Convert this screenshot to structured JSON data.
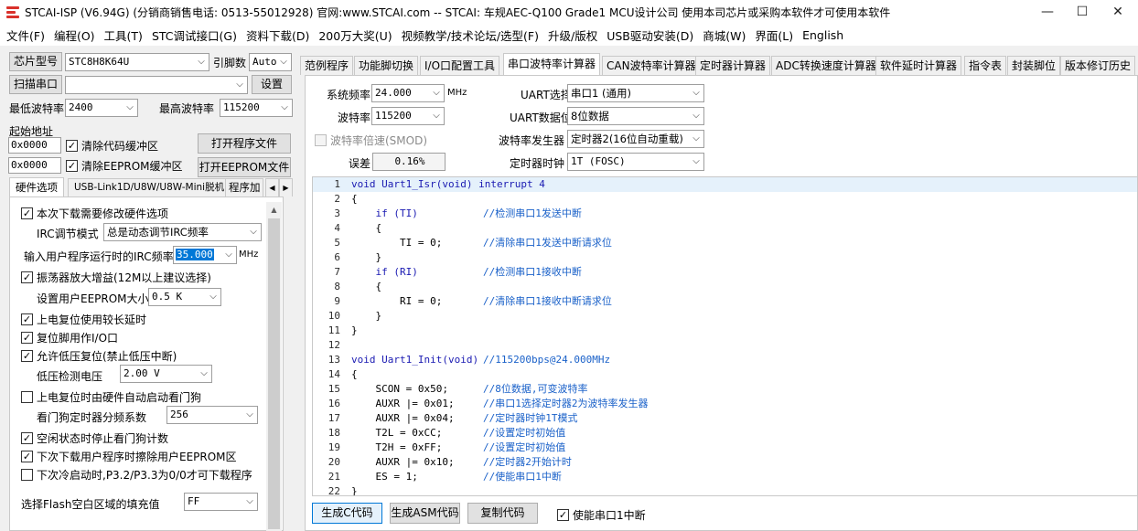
{
  "window": {
    "title": "STCAI-ISP (V6.94G) (分销商销售电话: 0513-55012928) 官网:www.STCAI.com  -- STCAI: 车规AEC-Q100 Grade1 MCU设计公司 使用本司芯片或采购本软件才可使用本软件",
    "minimize": "—",
    "maximize": "☐",
    "close": "✕"
  },
  "menu": [
    "文件(F)",
    "编程(O)",
    "工具(T)",
    "STC调试接口(G)",
    "资料下载(D)",
    "200万大奖(U)",
    "视频教学/技术论坛/选型(F)",
    "升级/版权",
    "USB驱动安装(D)",
    "商城(W)",
    "界面(L)",
    "English"
  ],
  "left": {
    "chip_label": "芯片型号",
    "chip_value": "STC8H8K64U",
    "pins_label": "引脚数",
    "pins_value": "Auto",
    "scan_label": "扫描串口",
    "port_value": "",
    "settings_label": "设置",
    "min_baud_label": "最低波特率",
    "min_baud_value": "2400",
    "max_baud_label": "最高波特率",
    "max_baud_value": "115200",
    "start_addr_label": "起始地址",
    "addr1": "0x0000",
    "clear_code_label": "清除代码缓冲区",
    "open_prog_label": "打开程序文件",
    "addr2": "0x0000",
    "clear_eeprom_label": "清除EEPROM缓冲区",
    "open_eeprom_label": "打开EEPROM文件",
    "tabs": [
      "硬件选项",
      "USB-Link1D/U8W/U8W-Mini脱机",
      "程序加"
    ],
    "options": {
      "modify_hw": "本次下载需要修改硬件选项",
      "irc_mode_label": "IRC调节模式",
      "irc_mode_value": "总是动态调节IRC频率",
      "irc_freq_label": "输入用户程序运行时的IRC频率",
      "irc_freq_value": "35.000",
      "irc_freq_unit": "MHz",
      "osc_gain": "振荡器放大增益(12M以上建议选择)",
      "eeprom_size_label": "设置用户EEPROM大小",
      "eeprom_size_value": "0.5 K",
      "long_delay": "上电复位使用较长延时",
      "reset_io": "复位脚用作I/O口",
      "lvd_reset": "允许低压复位(禁止低压中断)",
      "lvd_voltage_label": "低压检测电压",
      "lvd_voltage_value": "2.00 V",
      "wdt_auto": "上电复位时由硬件自动启动看门狗",
      "wdt_div_label": "看门狗定时器分频系数",
      "wdt_div_value": "256",
      "idle_wdt": "空闲状态时停止看门狗计数",
      "erase_eeprom": "下次下载用户程序时擦除用户EEPROM区",
      "p32_p33": "下次冷启动时,P3.2/P3.3为0/0才可下载程序",
      "fill_label": "选择Flash空白区域的填充值",
      "fill_value": "FF"
    }
  },
  "right": {
    "tabs": [
      "范例程序",
      "功能脚切换",
      "I/O口配置工具",
      "串口波特率计算器",
      "CAN波特率计算器",
      "定时器计算器",
      "ADC转换速度计算器",
      "软件延时计算器",
      "指令表",
      "封装脚位",
      "版本修订历史"
    ],
    "sysfreq_label": "系统频率",
    "sysfreq_value": "24.000",
    "sysfreq_unit": "MHz",
    "baud_label": "波特率",
    "baud_value": "115200",
    "smod_label": "波特率倍速(SMOD)",
    "error_label": "误差",
    "error_value": "0.16%",
    "uart_sel_label": "UART选择",
    "uart_sel_value": "串口1 (通用)",
    "uart_bits_label": "UART数据位",
    "uart_bits_value": "8位数据",
    "baud_gen_label": "波特率发生器",
    "baud_gen_value": "定时器2(16位自动重载)",
    "timer_clk_label": "定时器时钟",
    "timer_clk_value": "1T  (FOSC)",
    "code": [
      {
        "n": "1",
        "t": "void Uart1_Isr(void) interrupt 4",
        "c": ""
      },
      {
        "n": "2",
        "t": "{",
        "c": ""
      },
      {
        "n": "3",
        "t": "    if (TI)",
        "c": "//检测串口1发送中断"
      },
      {
        "n": "4",
        "t": "    {",
        "c": ""
      },
      {
        "n": "5",
        "t": "        TI = 0;",
        "c": "//清除串口1发送中断请求位"
      },
      {
        "n": "6",
        "t": "    }",
        "c": ""
      },
      {
        "n": "7",
        "t": "    if (RI)",
        "c": "//检测串口1接收中断"
      },
      {
        "n": "8",
        "t": "    {",
        "c": ""
      },
      {
        "n": "9",
        "t": "        RI = 0;",
        "c": "//清除串口1接收中断请求位"
      },
      {
        "n": "10",
        "t": "    }",
        "c": ""
      },
      {
        "n": "11",
        "t": "}",
        "c": ""
      },
      {
        "n": "12",
        "t": "",
        "c": ""
      },
      {
        "n": "13",
        "t": "void Uart1_Init(void)",
        "c": "//115200bps@24.000MHz"
      },
      {
        "n": "14",
        "t": "{",
        "c": ""
      },
      {
        "n": "15",
        "t": "    SCON = 0x50;",
        "c": "//8位数据,可变波特率"
      },
      {
        "n": "16",
        "t": "    AUXR |= 0x01;",
        "c": "//串口1选择定时器2为波特率发生器"
      },
      {
        "n": "17",
        "t": "    AUXR |= 0x04;",
        "c": "//定时器时钟1T模式"
      },
      {
        "n": "18",
        "t": "    T2L = 0xCC;",
        "c": "//设置定时初始值"
      },
      {
        "n": "19",
        "t": "    T2H = 0xFF;",
        "c": "//设置定时初始值"
      },
      {
        "n": "20",
        "t": "    AUXR |= 0x10;",
        "c": "//定时器2开始计时"
      },
      {
        "n": "21",
        "t": "    ES = 1;",
        "c": "//使能串口1中断"
      },
      {
        "n": "22",
        "t": "}",
        "c": ""
      }
    ],
    "gen_c_label": "生成C代码",
    "gen_asm_label": "生成ASM代码",
    "copy_label": "复制代码",
    "enable_int_label": "使能串口1中断"
  }
}
